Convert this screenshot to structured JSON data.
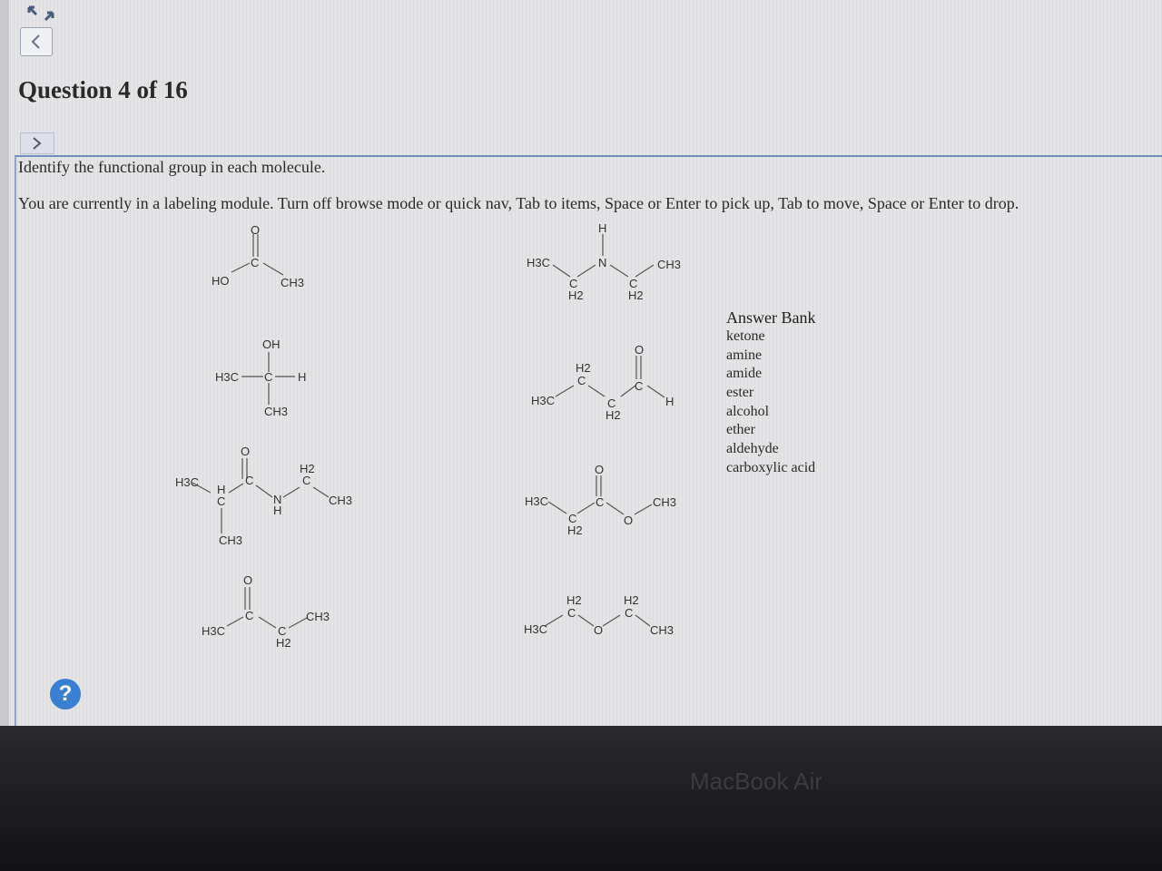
{
  "header": {
    "question_title": "Question 4 of 16"
  },
  "prompt": {
    "instruction": "Identify the functional group in each molecule.",
    "module_note": "You are currently in a labeling module. Turn off browse mode or quick nav, Tab to items, Space or Enter to pick up, Tab to move, Space or Enter to drop."
  },
  "answer_bank": {
    "title": "Answer Bank",
    "items": [
      "ketone",
      "amine",
      "amide",
      "ester",
      "alcohol",
      "ether",
      "aldehyde",
      "carboxylic acid"
    ]
  },
  "help": {
    "label": "?"
  },
  "device": {
    "label": "MacBook Air"
  },
  "icons": {
    "back": "chevron-left-icon",
    "next": "chevron-right-icon",
    "expand": "expand-arrows-icon",
    "help": "question-mark-icon"
  },
  "colors": {
    "accent": "#3b7fd0",
    "panel_border": "#6f8fbf"
  },
  "molecule_labels": {
    "carboxylic_acid": {
      "o": "O",
      "c": "C",
      "ho": "HO",
      "ch3": "CH3"
    },
    "amine": {
      "h": "H",
      "h3c": "H3C",
      "n": "N",
      "ch3": "CH3",
      "c1": "C",
      "h2a": "H2",
      "c2": "C",
      "h2b": "H2"
    },
    "alcohol": {
      "oh": "OH",
      "h3c": "H3C",
      "c": "C",
      "h": "H",
      "ch3": "CH3"
    },
    "aldehyde": {
      "h2": "H2",
      "c1": "C",
      "h3c": "H3C",
      "o": "O",
      "c2": "C",
      "h": "H",
      "c3": "C",
      "h2b": "H2"
    },
    "amide": {
      "h3c": "H3C",
      "h": "H",
      "c": "C",
      "o": "O",
      "c2": "C",
      "h2": "H2",
      "c3": "C",
      "n": "N",
      "nh": "H",
      "ch3": "CH3",
      "ch3b": "CH3"
    },
    "ester": {
      "o": "O",
      "h3c": "H3C",
      "c": "C",
      "ch3": "CH3",
      "c2": "C",
      "h2": "H2",
      "o2": "O"
    },
    "ketone": {
      "o": "O",
      "c": "C",
      "ch3": "CH3",
      "h3c": "H3C",
      "c2": "C",
      "h2": "H2"
    },
    "ether": {
      "h2a": "H2",
      "c1": "C",
      "h2b": "H2",
      "c2": "C",
      "h3c": "H3C",
      "o": "O",
      "ch3": "CH3"
    }
  }
}
